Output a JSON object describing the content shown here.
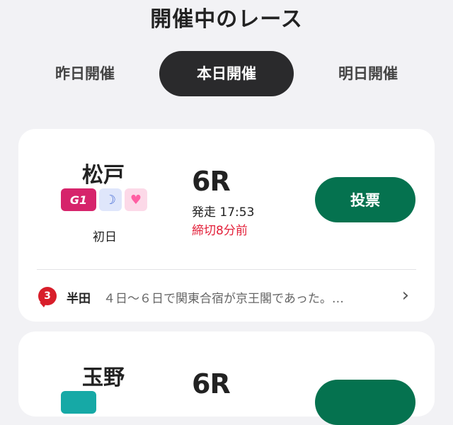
{
  "page": {
    "title": "開催中のレース"
  },
  "tabs": [
    {
      "label": "昨日開催",
      "active": false
    },
    {
      "label": "本日開催",
      "active": true
    },
    {
      "label": "明日開催",
      "active": false
    }
  ],
  "races": [
    {
      "venue": "松戸",
      "grade": "G1",
      "badges": [
        "night-icon",
        "heart-icon"
      ],
      "day": "初日",
      "race": "6R",
      "start": "発走 17:53",
      "deadline": "締切8分前",
      "vote_label": "投票",
      "news": {
        "count": "3",
        "author": "半田",
        "text": "４日〜６日で関東合宿が京王閣であった。…"
      }
    },
    {
      "venue": "玉野",
      "race": "6R"
    }
  ],
  "colors": {
    "accent": "#05724f",
    "grade_g1": "#d6246b",
    "deadline": "#e3203a",
    "tab_active": "#2a2a2c",
    "news_bubble": "#d81e2a"
  }
}
